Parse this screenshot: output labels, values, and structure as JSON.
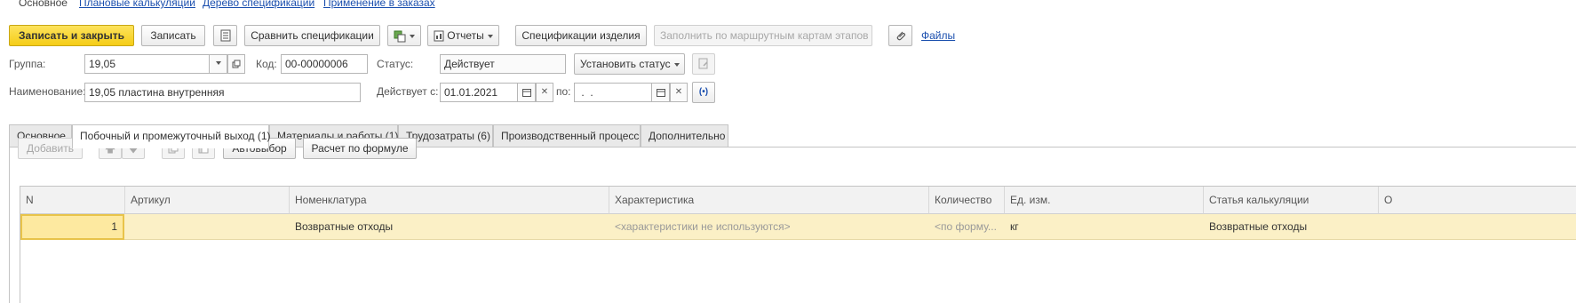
{
  "top_nav": {
    "current": "Основное",
    "links": [
      "Плановые калькуляции",
      "Дерево спецификации",
      "Применение в заказах"
    ]
  },
  "toolbar": {
    "save_close": "Записать и закрыть",
    "save": "Записать",
    "compare": "Сравнить спецификации",
    "reports": "Отчеты",
    "product_specs": "Спецификации изделия",
    "fill_routes": "Заполнить по маршрутным картам этапов",
    "files": "Файлы"
  },
  "form": {
    "group_label": "Группа:",
    "group_value": "19,05",
    "code_label": "Код:",
    "code_value": "00-00000006",
    "status_label": "Статус:",
    "status_value": "Действует",
    "set_status": "Установить статус",
    "name_label": "Наименование:",
    "name_value": "19,05 пластина внутренняя",
    "valid_from_label": "Действует с:",
    "valid_from_value": "01.01.2021",
    "valid_to_label": "по:",
    "valid_to_value": " .  ."
  },
  "tabs": [
    "Основное",
    "Побочный и промежуточный выход (1)",
    "Материалы и работы (1)",
    "Трудозатраты (6)",
    "Производственный процесс",
    "Дополнительно"
  ],
  "table_toolbar": {
    "add": "Добавить",
    "auto_select": "Автовыбор",
    "calc_formula": "Расчет по формуле"
  },
  "table": {
    "columns": [
      "N",
      "Артикул",
      "Номенклатура",
      "Характеристика",
      "Количество",
      "Ед. изм.",
      "Статья калькуляции",
      "О"
    ],
    "rows": [
      {
        "n": "1",
        "article": "",
        "nomenclature": "Возвратные отходы",
        "characteristic": "<характеристики не используются>",
        "quantity": "<по форму...",
        "unit": "кг",
        "cost_item": "Возвратные отходы"
      }
    ]
  },
  "colors": {
    "primary_button": "#f5cd17",
    "link": "#1b4fae",
    "selected_row": "#fbf0c6"
  }
}
